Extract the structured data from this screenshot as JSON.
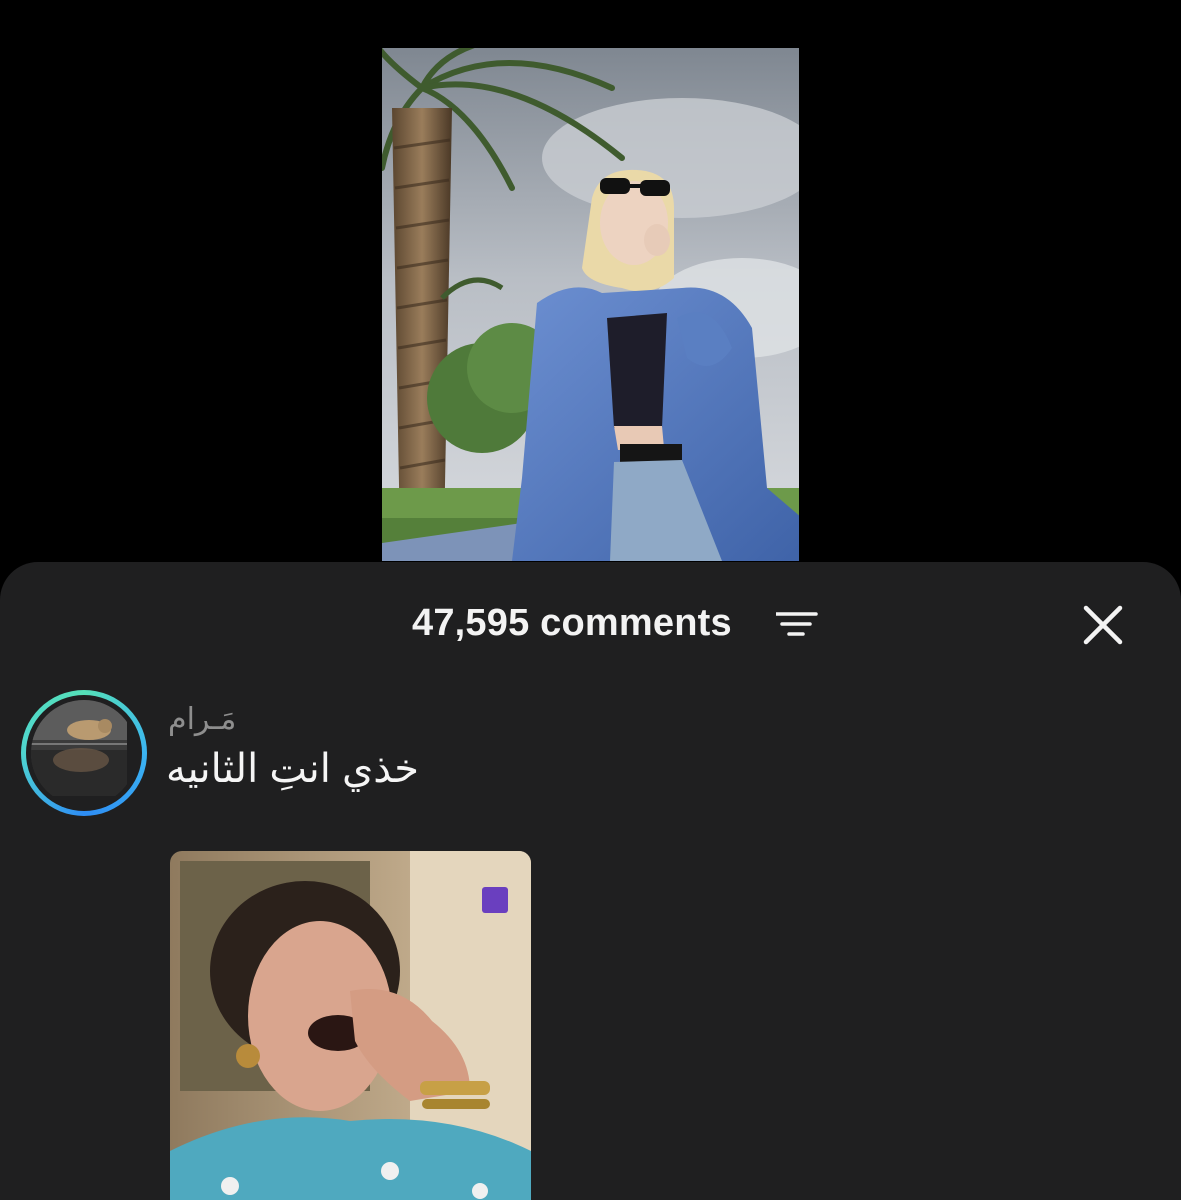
{
  "video": {
    "description_icon": "video-thumbnail"
  },
  "comments_sheet": {
    "count_label": "47,595 comments",
    "sort_icon": "sort-lines-icon",
    "close_icon": "close-icon"
  },
  "comment": {
    "username": "مَـرام",
    "text": "خذي انتِ الثانيه",
    "avatar_icon": "avatar",
    "attachment_icon": "gif-attachment"
  },
  "colors": {
    "background": "#000000",
    "sheet": "#1f1f20",
    "primary_text": "#f3f3f3",
    "secondary_text": "#8e8e8e",
    "story_ring_start": "#55e0b8",
    "story_ring_end": "#2e8df5"
  }
}
